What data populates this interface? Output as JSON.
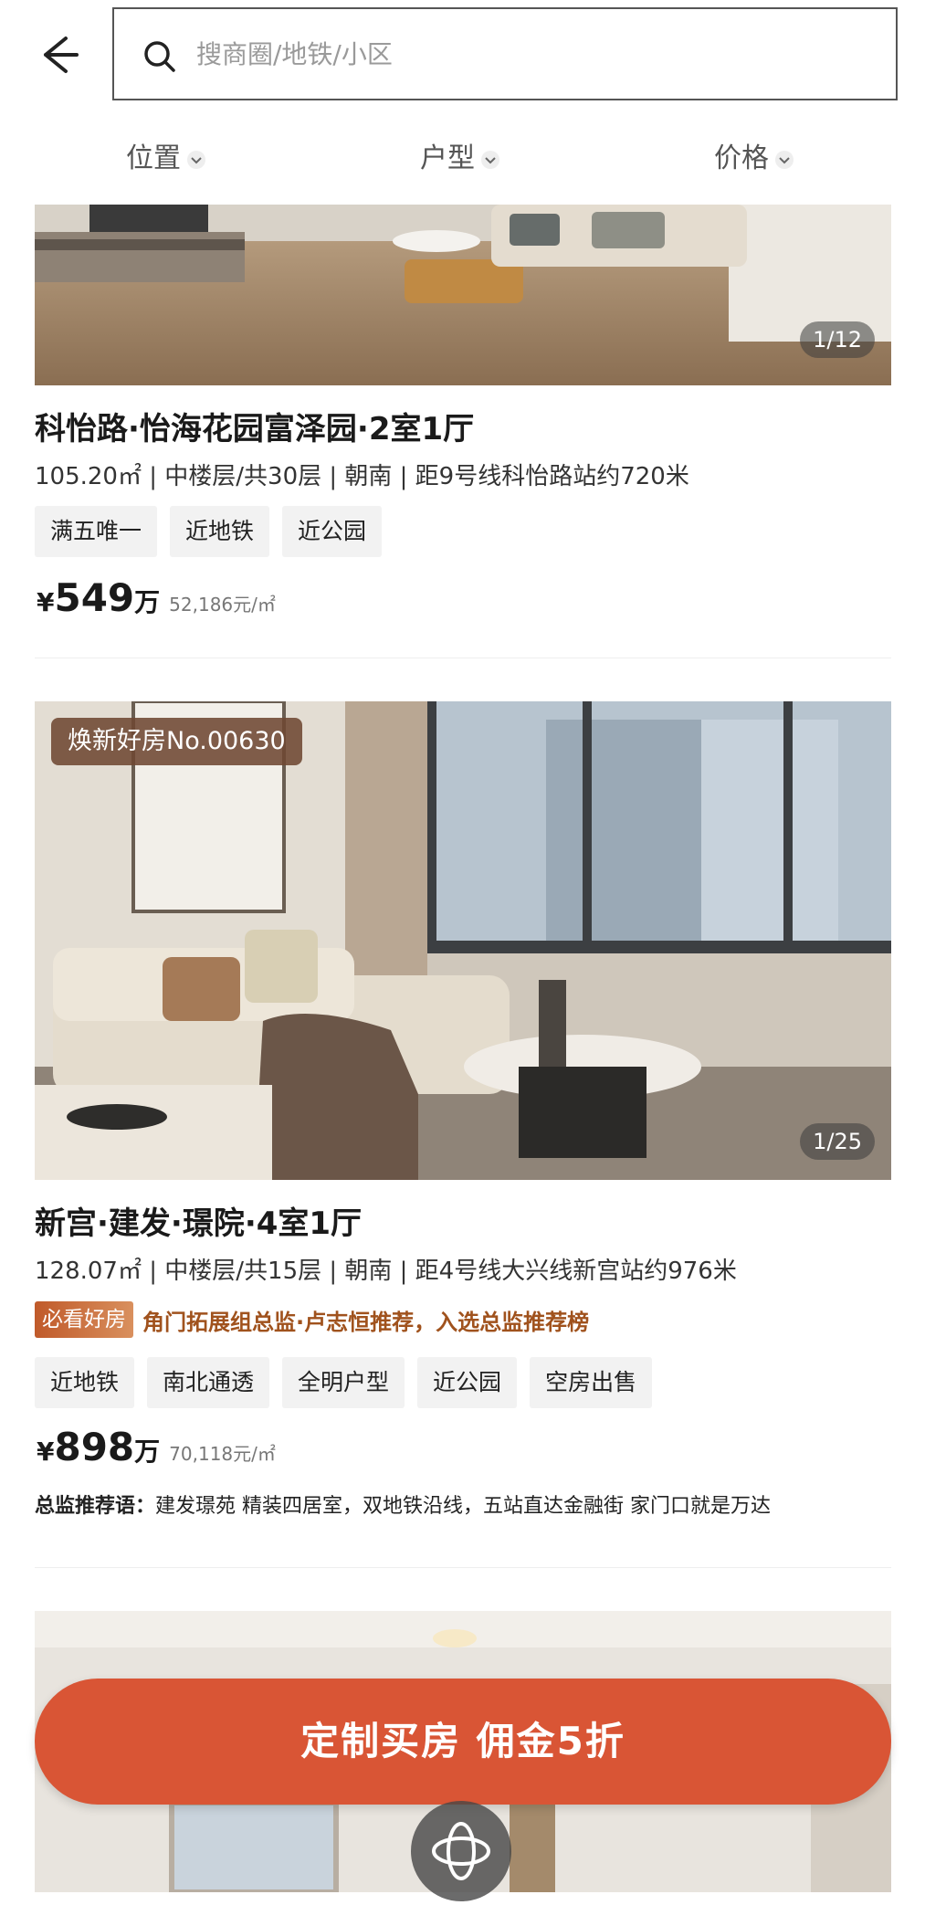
{
  "header": {
    "search_placeholder": "搜商圈/地铁/小区"
  },
  "filters": [
    {
      "label": "位置"
    },
    {
      "label": "户型"
    },
    {
      "label": "价格"
    }
  ],
  "listings": [
    {
      "photo_counter": "1/12",
      "title": "科怡路·怡海花园富泽园·2室1厅",
      "meta": "105.20㎡ | 中楼层/共30层 | 朝南 | 距9号线科怡路站约720米",
      "tags": [
        "满五唯一",
        "近地铁",
        "近公园"
      ],
      "price_currency": "¥",
      "price": "549",
      "price_unit": "万",
      "unit_price": "52,186元/㎡"
    },
    {
      "photo_badge": "焕新好房No.00630",
      "photo_counter": "1/25",
      "title": "新宫·建发·璟院·4室1厅",
      "meta": "128.07㎡ | 中楼层/共15层 | 朝南 | 距4号线大兴线新宫站约976米",
      "recommend_badge": "必看好房",
      "recommend_text": "角门拓展组总监·卢志恒推荐，入选总监推荐榜",
      "tags": [
        "近地铁",
        "南北通透",
        "全明户型",
        "近公园",
        "空房出售"
      ],
      "price_currency": "¥",
      "price": "898",
      "price_unit": "万",
      "unit_price": "70,118元/㎡",
      "director_label": "总监推荐语：",
      "director_text": "建发璟苑 精装四居室，双地铁沿线，五站直达金融街 家门口就是万达"
    }
  ],
  "cta": {
    "label": "定制买房 佣金5折"
  },
  "colors": {
    "cta": "#d95535",
    "recommend_text": "#a0521d"
  }
}
